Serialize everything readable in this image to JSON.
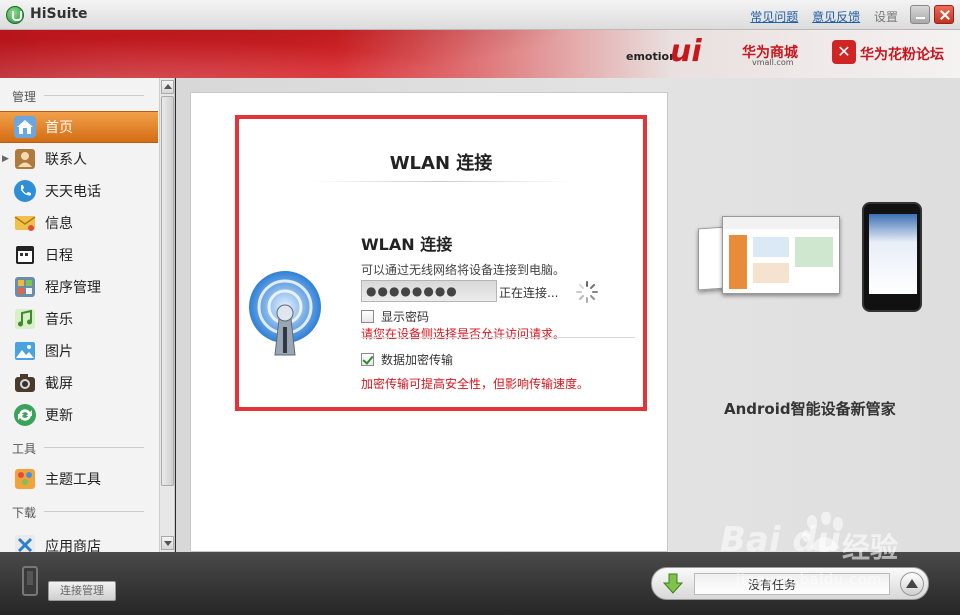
{
  "app": {
    "title": "HiSuite",
    "links": {
      "faq": "常见问题",
      "feedback": "意见反馈",
      "settings": "设置"
    }
  },
  "banner": {
    "emotion": "emotion",
    "ui": "ui",
    "vmall": "华为商城",
    "vmall_sub": "vmall.com",
    "fans": "华为花粉论坛"
  },
  "sidebar": {
    "sections": {
      "manage": "管理",
      "tools": "工具",
      "download": "下载"
    },
    "items": [
      {
        "label": "首页",
        "icon": "home-icon",
        "active": true
      },
      {
        "label": "联系人",
        "icon": "contacts-icon",
        "active": false
      },
      {
        "label": "天天电话",
        "icon": "phone-icon",
        "active": false
      },
      {
        "label": "信息",
        "icon": "message-icon",
        "active": false
      },
      {
        "label": "日程",
        "icon": "calendar-icon",
        "active": false
      },
      {
        "label": "程序管理",
        "icon": "apps-icon",
        "active": false
      },
      {
        "label": "音乐",
        "icon": "music-icon",
        "active": false
      },
      {
        "label": "图片",
        "icon": "picture-icon",
        "active": false
      },
      {
        "label": "截屏",
        "icon": "camera-icon",
        "active": false
      },
      {
        "label": "更新",
        "icon": "update-icon",
        "active": false
      },
      {
        "label": "主题工具",
        "icon": "theme-icon",
        "active": false
      },
      {
        "label": "应用商店",
        "icon": "store-icon",
        "active": false
      }
    ]
  },
  "dialog": {
    "title": "WLAN 连接",
    "content_title": "WLAN 连接",
    "description": "可以通过无线网络将设备连接到电脑。",
    "password_value": "●●●●●●●●",
    "connecting": "正在连接...",
    "show_password": "显示密码",
    "show_password_checked": false,
    "warning": "请您在设备侧选择是否允许访问请求。",
    "encrypt_label": "数据加密传输",
    "encrypt_checked": true,
    "encrypt_note": "加密传输可提高安全性，但影响传输速度。"
  },
  "promo": {
    "caption": "Android智能设备新管家"
  },
  "bottom": {
    "connection_manage": "连接管理",
    "no_tasks": "没有任务"
  },
  "watermark": {
    "logo": "Bai du",
    "cn": "经验",
    "url": "jingyan.baidu.com"
  },
  "colors": {
    "accent_orange": "#e0831f",
    "highlight_red": "#e5333a",
    "warning_red": "#d9151d"
  }
}
